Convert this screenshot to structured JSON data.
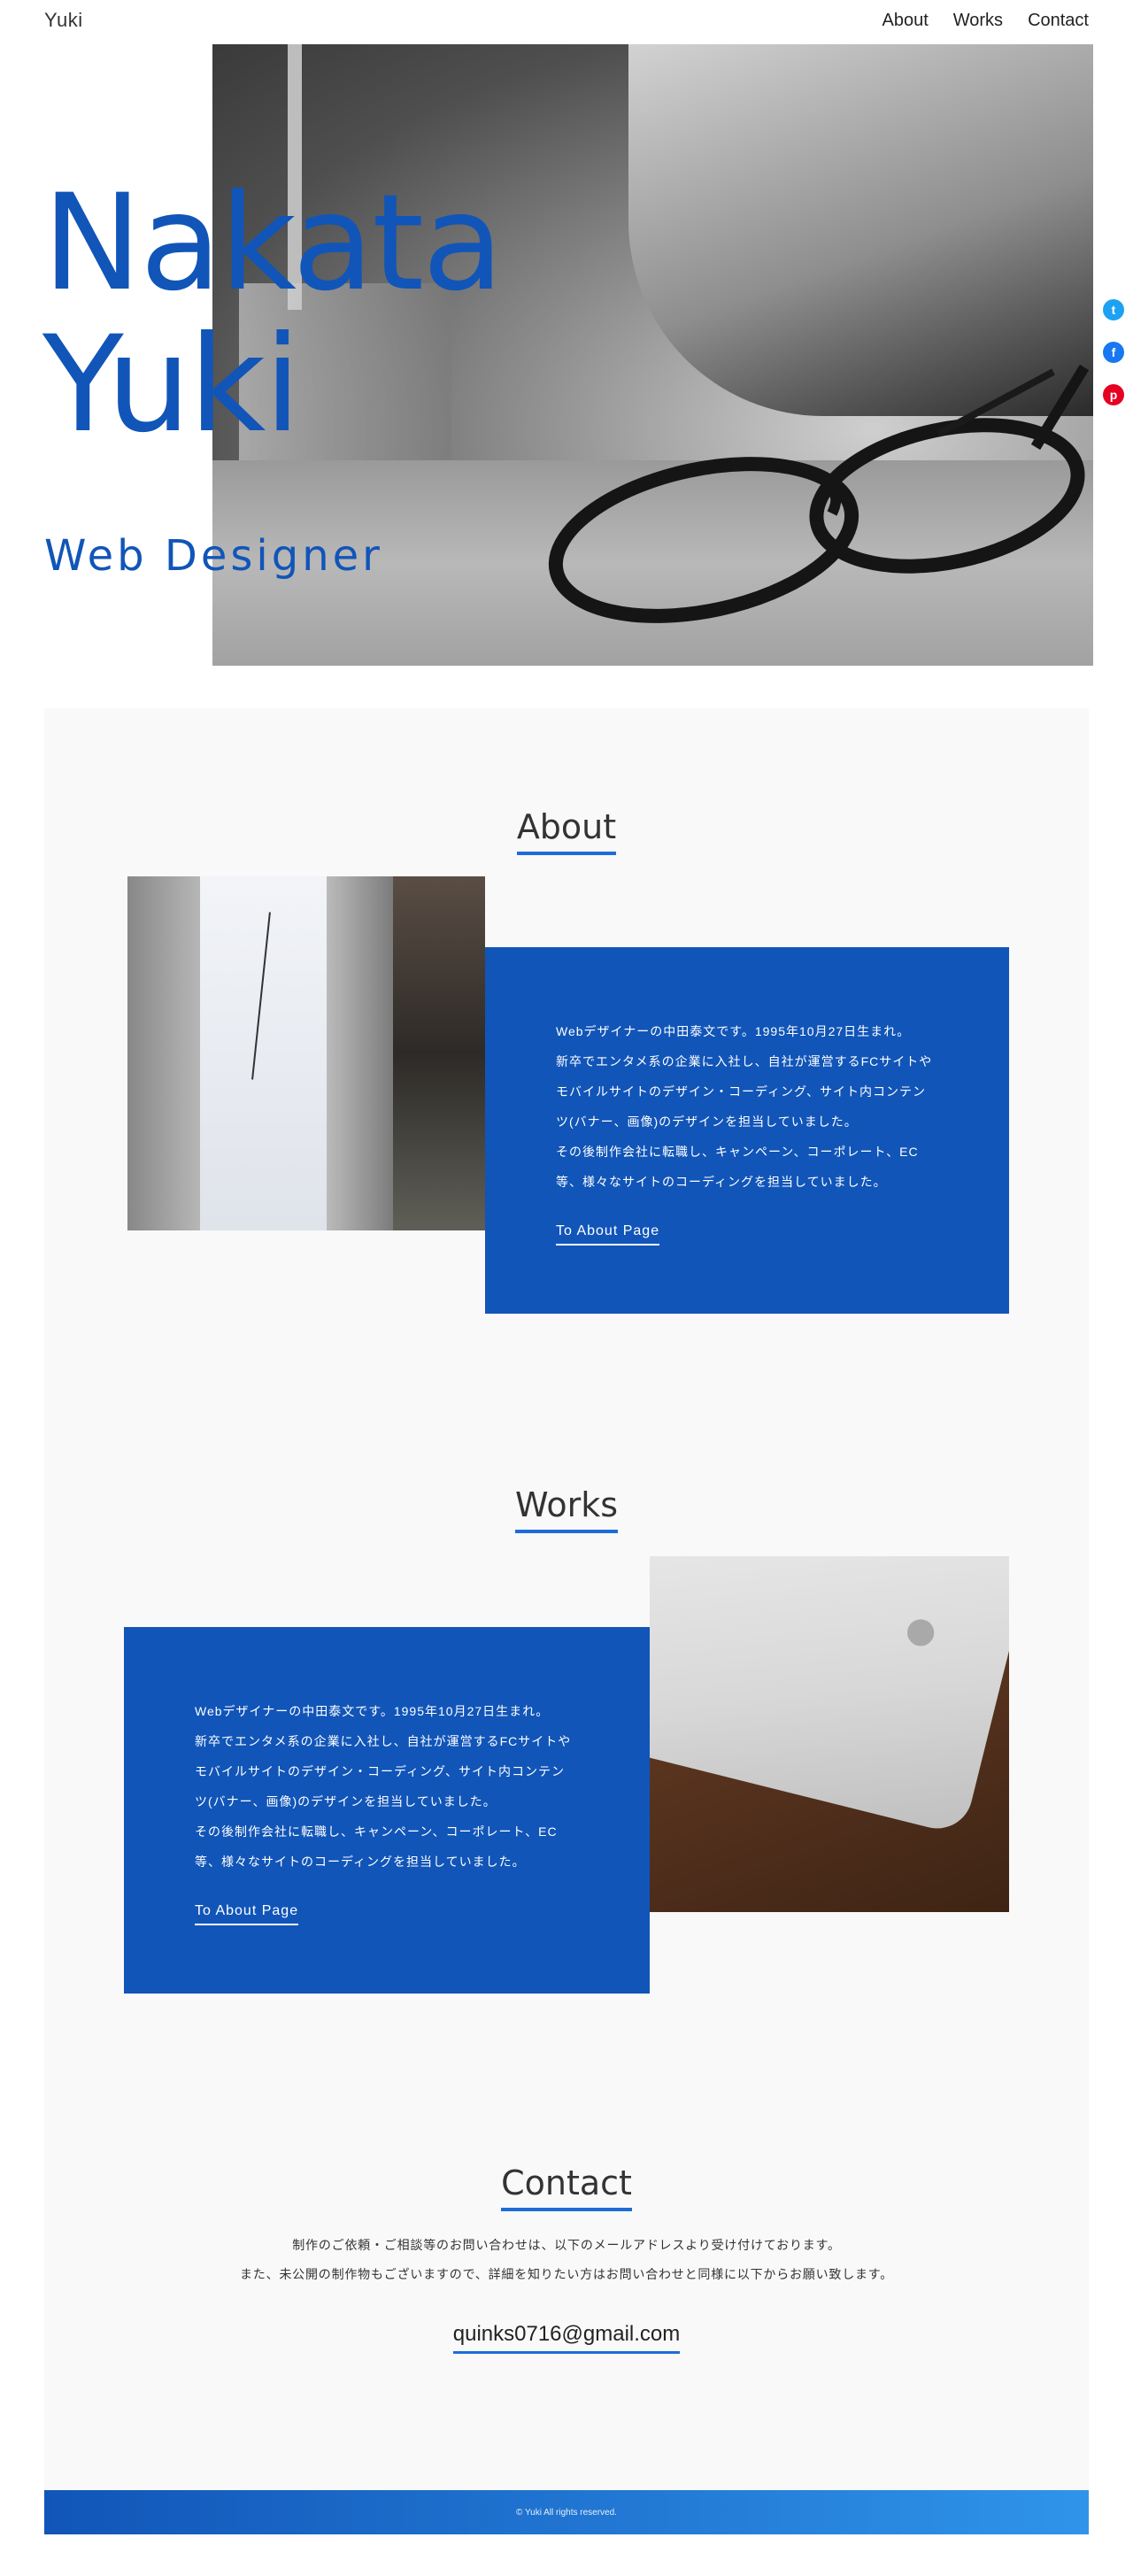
{
  "header": {
    "logo": "Yuki",
    "nav": [
      "About",
      "Works",
      "Contact"
    ]
  },
  "hero": {
    "name_line1": "Nakata",
    "name_line2": "Yuki",
    "role": "Web Designer",
    "share_icons": [
      "twitter-icon",
      "facebook-icon",
      "pinterest-icon"
    ]
  },
  "about": {
    "title": "About",
    "paragraphs": [
      "Webデザイナーの中田泰文です。1995年10月27日生まれ。",
      "新卒でエンタメ系の企業に入社し、自社が運営するFCサイトや",
      "モバイルサイトのデザイン・コーディング、サイト内コンテン",
      "ツ(バナー、画像)のデザインを担当していました。",
      "その後制作会社に転職し、キャンペーン、コーポレート、EC",
      "等、様々なサイトのコーディングを担当していました。"
    ],
    "link": "To About Page"
  },
  "works": {
    "title": "Works",
    "paragraphs": [
      "Webデザイナーの中田泰文です。1995年10月27日生まれ。",
      "新卒でエンタメ系の企業に入社し、自社が運営するFCサイトや",
      "モバイルサイトのデザイン・コーディング、サイト内コンテン",
      "ツ(バナー、画像)のデザインを担当していました。",
      "その後制作会社に転職し、キャンペーン、コーポレート、EC",
      "等、様々なサイトのコーディングを担当していました。"
    ],
    "link": "To About Page"
  },
  "contact": {
    "title": "Contact",
    "lines": [
      "制作のご依頼・ご相談等のお問い合わせは、以下のメールアドレスより受け付けております。",
      "また、未公開の制作物もございますので、詳細を知りたい方はお問い合わせと同様に以下からお願い致します。"
    ],
    "email": "quinks0716@gmail.com"
  },
  "footer": {
    "copyright": "© Yuki All rights reserved."
  },
  "colors": {
    "brand_blue": "#1155b8",
    "accent_blue": "#1e6cd8",
    "twitter": "#1da1f2",
    "facebook": "#1877f2",
    "pinterest": "#e60023"
  }
}
